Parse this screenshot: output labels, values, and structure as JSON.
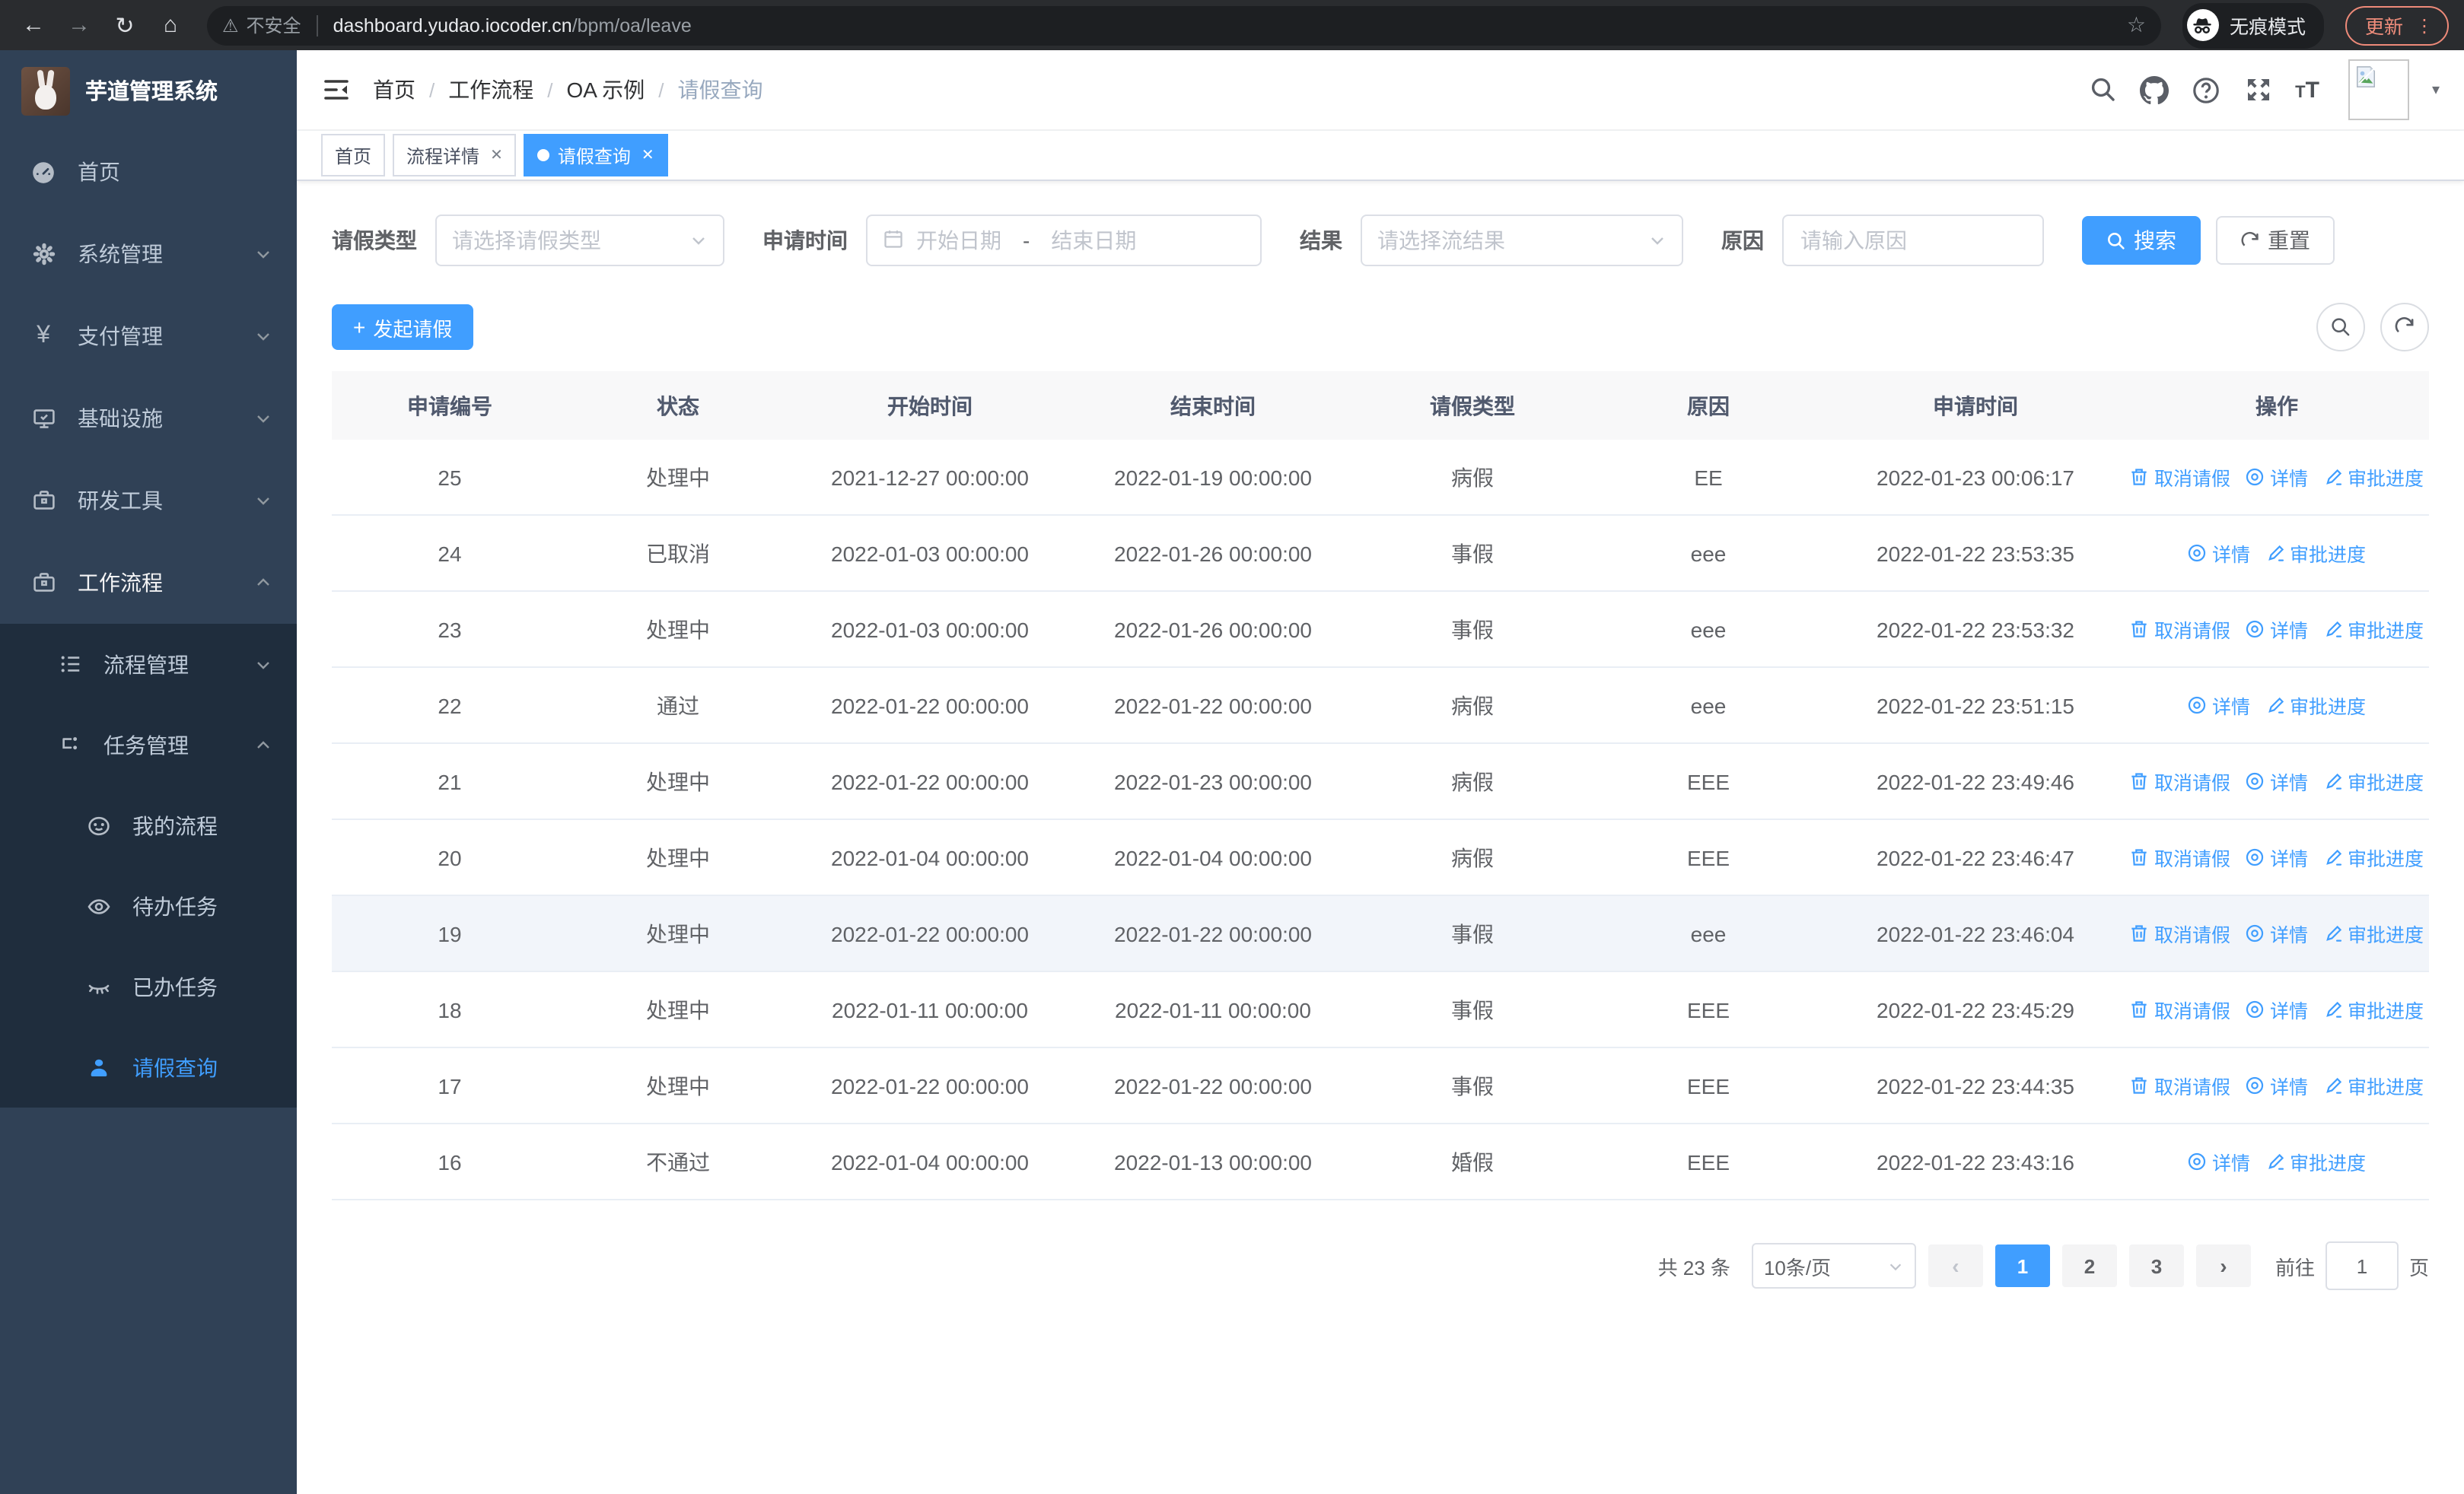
{
  "browser": {
    "security_label": "不安全",
    "url_host": "dashboard.yudao.iocoder.cn",
    "url_path": "/bpm/oa/leave",
    "incognito_label": "无痕模式",
    "update_label": "更新"
  },
  "colors": {
    "accent": "#409eff",
    "sidebar_bg": "#304156",
    "submenu_bg": "#1f2d3d",
    "table_header_bg": "#f8f8f9",
    "update_pill": "#f08d7b"
  },
  "sidebar": {
    "title": "芋道管理系统",
    "items": [
      {
        "label": "首页",
        "icon": "dashboard-icon"
      },
      {
        "label": "系统管理",
        "icon": "gear-icon",
        "chevron": "down"
      },
      {
        "label": "支付管理",
        "icon": "yen-icon",
        "chevron": "down"
      },
      {
        "label": "基础设施",
        "icon": "monitor-icon",
        "chevron": "down"
      },
      {
        "label": "研发工具",
        "icon": "toolbox-icon",
        "chevron": "down"
      },
      {
        "label": "工作流程",
        "icon": "toolbox-icon",
        "chevron": "up"
      }
    ],
    "submenu": [
      {
        "label": "流程管理",
        "icon": "list-icon",
        "chevron": "down"
      },
      {
        "label": "任务管理",
        "icon": "tree-icon",
        "chevron": "up"
      }
    ],
    "tasks": [
      {
        "label": "我的流程",
        "icon": "face-icon"
      },
      {
        "label": "待办任务",
        "icon": "eye-open-icon"
      },
      {
        "label": "已办任务",
        "icon": "eye-closed-icon"
      },
      {
        "label": "请假查询",
        "icon": "person-icon",
        "active": true
      }
    ]
  },
  "navbar": {
    "breadcrumb": [
      "首页",
      "工作流程",
      "OA 示例",
      "请假查询"
    ]
  },
  "tags": [
    {
      "label": "首页"
    },
    {
      "label": "流程详情",
      "closable": true
    },
    {
      "label": "请假查询",
      "closable": true,
      "active": true
    }
  ],
  "filters": {
    "leave_type_label": "请假类型",
    "leave_type_placeholder": "请选择请假类型",
    "apply_time_label": "申请时间",
    "date_start_placeholder": "开始日期",
    "date_separator": "-",
    "date_end_placeholder": "结束日期",
    "result_label": "结果",
    "result_placeholder": "请选择流结果",
    "reason_label": "原因",
    "reason_placeholder": "请输入原因",
    "search_label": "搜索",
    "reset_label": "重置"
  },
  "toolbar": {
    "create_label": "发起请假"
  },
  "table": {
    "columns": [
      "申请编号",
      "状态",
      "开始时间",
      "结束时间",
      "请假类型",
      "原因",
      "申请时间",
      "操作"
    ],
    "action_labels": {
      "cancel": "取消请假",
      "detail": "详情",
      "progress": "审批进度"
    },
    "action_icons": {
      "cancel": "trash-icon",
      "detail": "eye-icon",
      "progress": "pen-icon"
    },
    "rows": [
      {
        "id": "25",
        "status": "处理中",
        "start": "2021-12-27 00:00:00",
        "end": "2022-01-19 00:00:00",
        "type": "病假",
        "reason": "EE",
        "apply_time": "2022-01-23 00:06:17",
        "actions": [
          "cancel",
          "detail",
          "progress"
        ]
      },
      {
        "id": "24",
        "status": "已取消",
        "start": "2022-01-03 00:00:00",
        "end": "2022-01-26 00:00:00",
        "type": "事假",
        "reason": "eee",
        "apply_time": "2022-01-22 23:53:35",
        "actions": [
          "detail",
          "progress"
        ]
      },
      {
        "id": "23",
        "status": "处理中",
        "start": "2022-01-03 00:00:00",
        "end": "2022-01-26 00:00:00",
        "type": "事假",
        "reason": "eee",
        "apply_time": "2022-01-22 23:53:32",
        "actions": [
          "cancel",
          "detail",
          "progress"
        ]
      },
      {
        "id": "22",
        "status": "通过",
        "start": "2022-01-22 00:00:00",
        "end": "2022-01-22 00:00:00",
        "type": "病假",
        "reason": "eee",
        "apply_time": "2022-01-22 23:51:15",
        "actions": [
          "detail",
          "progress"
        ]
      },
      {
        "id": "21",
        "status": "处理中",
        "start": "2022-01-22 00:00:00",
        "end": "2022-01-23 00:00:00",
        "type": "病假",
        "reason": "EEE",
        "apply_time": "2022-01-22 23:49:46",
        "actions": [
          "cancel",
          "detail",
          "progress"
        ]
      },
      {
        "id": "20",
        "status": "处理中",
        "start": "2022-01-04 00:00:00",
        "end": "2022-01-04 00:00:00",
        "type": "病假",
        "reason": "EEE",
        "apply_time": "2022-01-22 23:46:47",
        "actions": [
          "cancel",
          "detail",
          "progress"
        ]
      },
      {
        "id": "19",
        "status": "处理中",
        "start": "2022-01-22 00:00:00",
        "end": "2022-01-22 00:00:00",
        "type": "事假",
        "reason": "eee",
        "apply_time": "2022-01-22 23:46:04",
        "actions": [
          "cancel",
          "detail",
          "progress"
        ],
        "highlight": true
      },
      {
        "id": "18",
        "status": "处理中",
        "start": "2022-01-11 00:00:00",
        "end": "2022-01-11 00:00:00",
        "type": "事假",
        "reason": "EEE",
        "apply_time": "2022-01-22 23:45:29",
        "actions": [
          "cancel",
          "detail",
          "progress"
        ]
      },
      {
        "id": "17",
        "status": "处理中",
        "start": "2022-01-22 00:00:00",
        "end": "2022-01-22 00:00:00",
        "type": "事假",
        "reason": "EEE",
        "apply_time": "2022-01-22 23:44:35",
        "actions": [
          "cancel",
          "detail",
          "progress"
        ]
      },
      {
        "id": "16",
        "status": "不通过",
        "start": "2022-01-04 00:00:00",
        "end": "2022-01-13 00:00:00",
        "type": "婚假",
        "reason": "EEE",
        "apply_time": "2022-01-22 23:43:16",
        "actions": [
          "detail",
          "progress"
        ]
      }
    ]
  },
  "pagination": {
    "total_label": "共 23 条",
    "page_size": "10条/页",
    "pages": [
      "1",
      "2",
      "3"
    ],
    "active_page": "1",
    "goto_label": "前往",
    "goto_value": "1",
    "page_suffix_label": "页"
  }
}
